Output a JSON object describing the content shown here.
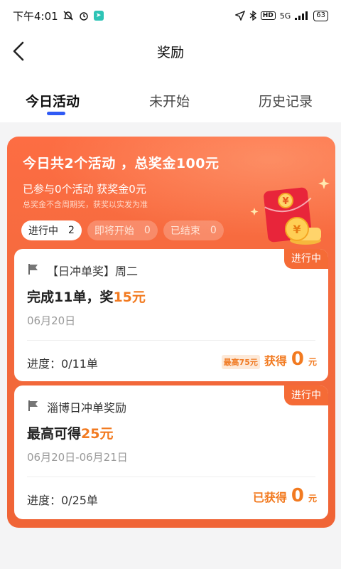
{
  "statusbar": {
    "time": "下午4:01",
    "signal": "5G",
    "battery": "63"
  },
  "header": {
    "title": "奖励"
  },
  "tabs": [
    {
      "label": "今日活动",
      "active": true
    },
    {
      "label": "未开始",
      "active": false
    },
    {
      "label": "历史记录",
      "active": false
    }
  ],
  "summary": {
    "headline": "今日共2个活动 ，总奖金100元",
    "subline": "已参与0个活动 获奖金0元",
    "note": "总奖金不含周期奖，获奖以实发为准"
  },
  "filters": [
    {
      "label": "进行中",
      "count": "2",
      "active": true
    },
    {
      "label": "即将开始",
      "count": "0",
      "active": false
    },
    {
      "label": "已结束",
      "count": "0",
      "active": false
    }
  ],
  "cards": [
    {
      "status": "进行中",
      "title": "【日冲单奖】周二",
      "reward_prefix": "完成11单，奖",
      "reward_amount": "15元",
      "date": "06月20日",
      "progress": "进度：0/11单",
      "max_tag": "最高75元",
      "earn_label": "获得",
      "earn_value": "0",
      "earn_unit": "元"
    },
    {
      "status": "进行中",
      "title": "淄博日冲单奖励",
      "reward_prefix": "最高可得",
      "reward_amount": "25元",
      "date": "06月20日-06月21日",
      "progress": "进度：0/25单",
      "earn_label": "已获得",
      "earn_value": "0",
      "earn_unit": "元"
    }
  ],
  "colors": {
    "accent": "#f56b36",
    "reward": "#f27a20",
    "tab_indicator": "#2f5af5"
  },
  "icons": {
    "back": "chevron-left-icon",
    "flag": "flag-icon",
    "red_envelope": "red-envelope-icon"
  }
}
